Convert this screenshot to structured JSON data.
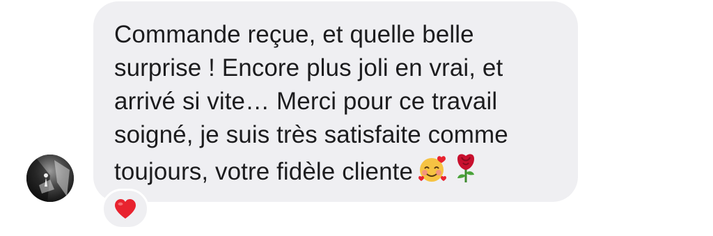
{
  "message": {
    "text": "Commande reçue, et quelle belle surprise ! Encore plus joli en vrai, et arrivé si vite… Merci pour ce travail soigné, je suis très satisfaite comme toujours, votre fidèle cliente",
    "trailing_emojis": [
      "smiling-face-with-hearts",
      "rose"
    ],
    "bubble_color": "#efeff2",
    "text_color": "#1c1c1e"
  },
  "sender": {
    "avatar_icon": "profile-photo"
  },
  "reaction": {
    "emoji": "red-heart",
    "color": "#e8232f"
  }
}
